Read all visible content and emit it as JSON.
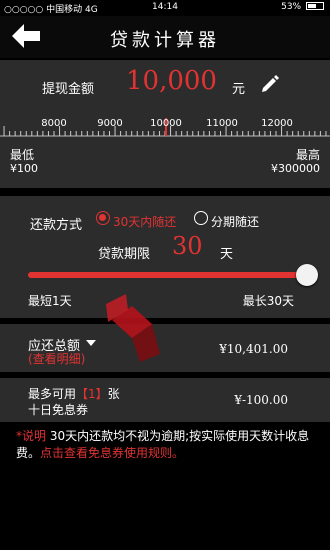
{
  "status": {
    "carrier": "○○○○○ 中国移动  4G",
    "time": "14:14",
    "battery": "53%"
  },
  "header": {
    "title": "贷款计算器"
  },
  "amount": {
    "label": "提现金额",
    "value": "10,000",
    "unit": "元",
    "ruler_ticks": [
      "8000",
      "9000",
      "10000",
      "11000",
      "12000"
    ],
    "min_label": "最低",
    "max_label": "最高",
    "min_value": "¥100",
    "max_value": "¥300000"
  },
  "repay": {
    "label": "还款方式",
    "option1": "30天内随还",
    "option2": "分期随还",
    "selected": "option1",
    "term_label": "贷款期限",
    "term_value": "30",
    "term_unit": "天",
    "slider_level": 1.0,
    "shortest": "最短1天",
    "longest": "最长30天"
  },
  "due": {
    "label": "应还总额",
    "detail_link": "(查看明细)",
    "value": "¥10,401.00"
  },
  "coupon": {
    "line1_prefix": "最多可用",
    "count": "【1】",
    "line1_suffix": "张",
    "line2": "十日免息券",
    "value": "¥-100.00"
  },
  "note": {
    "prefix": "*说明",
    "body": "   30天内还款均不视为逾期;按实际使用天数计收息费。",
    "link": "点击查看免息券使用规则。"
  },
  "colors": {
    "accent": "#e23333",
    "panel": "#2c2c2c",
    "background": "#000000"
  }
}
